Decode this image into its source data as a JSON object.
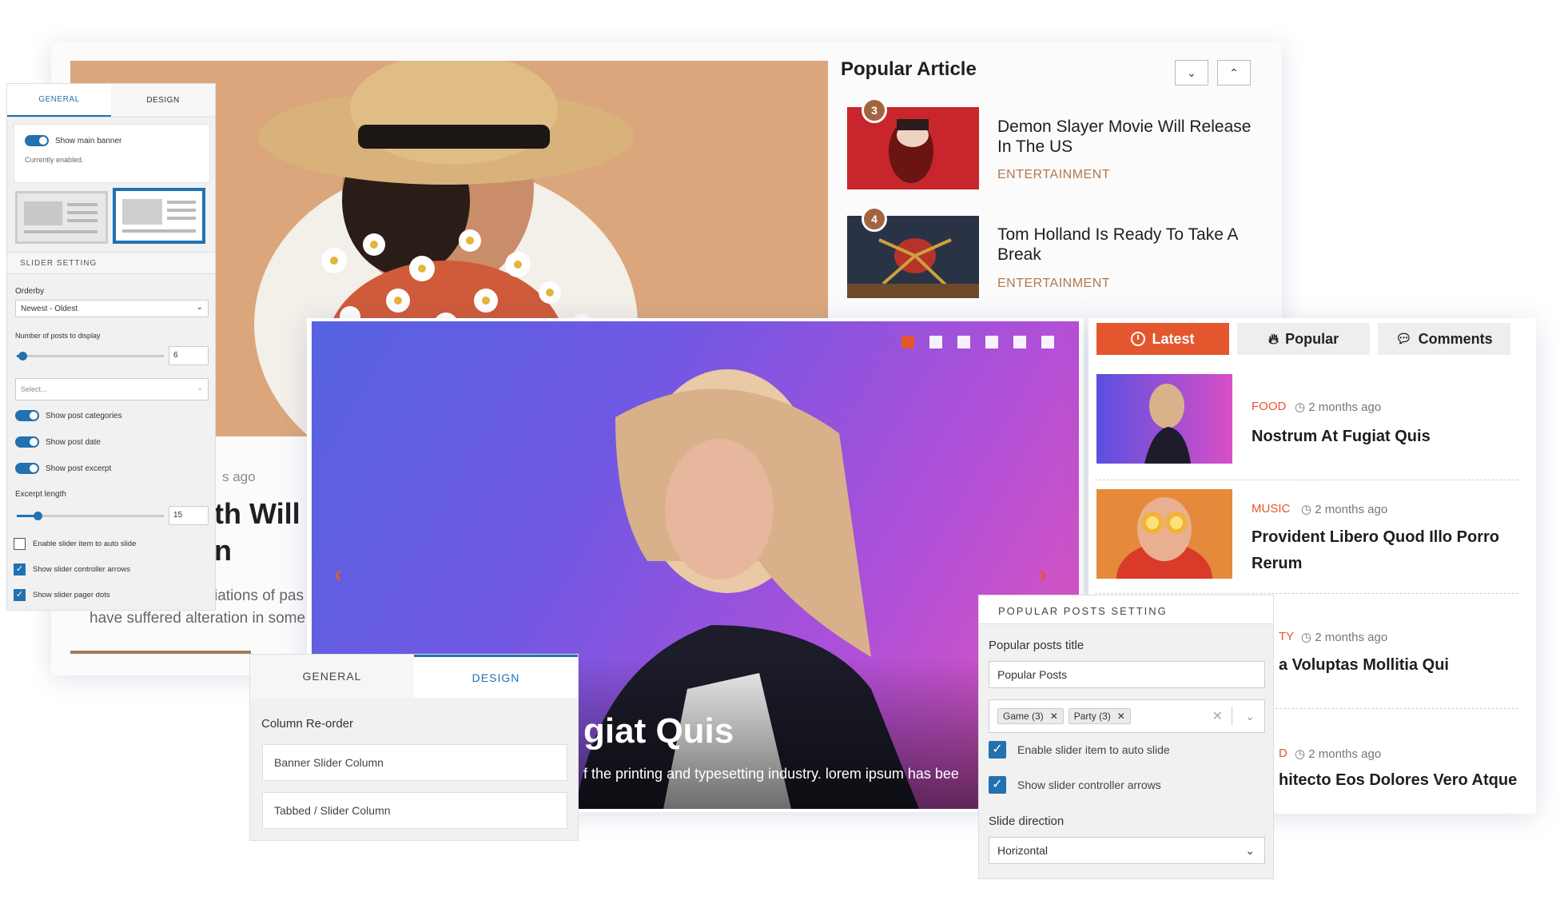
{
  "back_card": {
    "meta_ago": "s ago",
    "title_line1": "th Will E",
    "title_line2": "n",
    "excerpt_line1": "iations of pas",
    "excerpt_line2": "have suffered alteration in some"
  },
  "popular_article": {
    "heading": "Popular Article",
    "nav_down": "⌄",
    "nav_up": "⌃",
    "items": [
      {
        "number": "3",
        "title": "Demon Slayer Movie Will Release In The US",
        "category": "ENTERTAINMENT"
      },
      {
        "number": "4",
        "title": "Tom Holland Is Ready To Take A Break",
        "category": "ENTERTAINMENT"
      }
    ]
  },
  "left_panel": {
    "tab_general": "GENERAL",
    "tab_design": "DESIGN",
    "show_main_banner": "Show main banner",
    "currently_enabled": "Currently enabled.",
    "slider_setting": "SLIDER SETTING",
    "orderby_label": "Orderby",
    "orderby_value": "Newest - Oldest",
    "num_posts_label": "Number of posts to display",
    "num_posts_value": "6",
    "num_posts_fraction": 0.04,
    "select_placeholder": "Select...",
    "show_post_categories": "Show post categories",
    "show_post_date": "Show post date",
    "show_post_excerpt": "Show post excerpt",
    "excerpt_length_label": "Excerpt length",
    "excerpt_length_value": "15",
    "excerpt_length_fraction": 0.14,
    "enable_auto_slide": "Enable slider item to auto slide",
    "show_arrows": "Show slider controller arrows",
    "show_pager_dots": "Show slider pager dots"
  },
  "slider": {
    "title": "giat Quis",
    "subtitle": "f the printing and typesetting industry. lorem ipsum has bee",
    "prev_arrow": "‹",
    "next_arrow": "›",
    "active_dot_color": "#e4572e"
  },
  "tabbed": {
    "tabs": [
      {
        "label": "Latest",
        "icon": "clock-icon"
      },
      {
        "label": "Popular",
        "icon": "flame-icon"
      },
      {
        "label": "Comments",
        "icon": "comments-icon"
      }
    ],
    "accent": "#e4572e",
    "items": [
      {
        "category": "FOOD",
        "time": "2 months ago",
        "title": "Nostrum At Fugiat Quis"
      },
      {
        "category": "MUSIC",
        "time": "2 months ago",
        "title": "Provident Libero Quod Illo Porro Rerum"
      },
      {
        "category": "TY",
        "time": "2 months ago",
        "title": "a Voluptas Mollitia Qui"
      },
      {
        "category": "D",
        "time": "2 months ago",
        "title": "hitecto Eos Dolores Vero Atque"
      }
    ]
  },
  "design_panel": {
    "tab_general": "GENERAL",
    "tab_design": "DESIGN",
    "column_reorder": "Column Re-order",
    "columns": [
      "Banner Slider Column",
      "Tabbed / Slider Column"
    ]
  },
  "popular_posts_setting": {
    "heading": "POPULAR POSTS SETTING",
    "title_label": "Popular posts title",
    "title_value": "Popular Posts",
    "tags": [
      "Game (3)",
      "Party (3)"
    ],
    "enable_auto_slide": "Enable slider item to auto slide",
    "show_arrows": "Show slider controller arrows",
    "slide_direction_label": "Slide direction",
    "slide_direction_value": "Horizontal"
  }
}
